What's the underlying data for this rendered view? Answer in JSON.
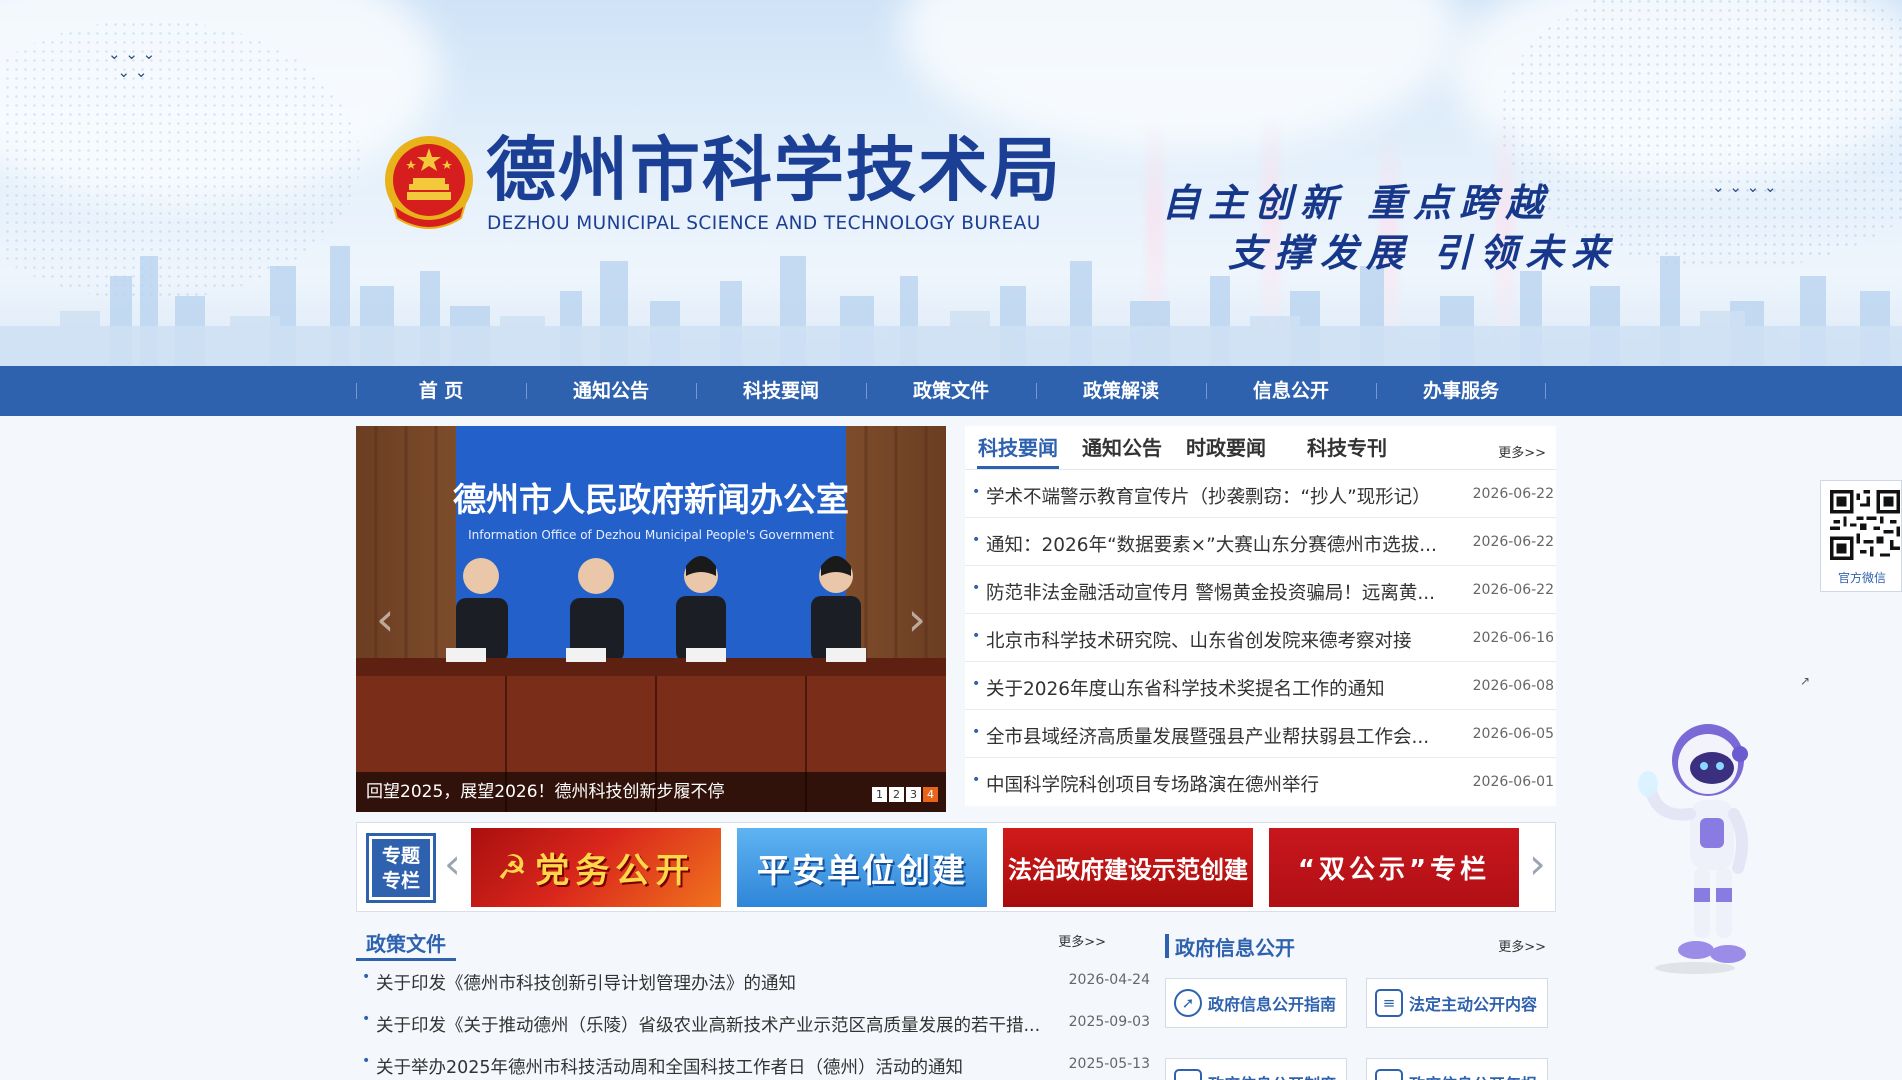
{
  "header": {
    "title": "德州市科学技术局",
    "subtitle": "DEZHOU MUNICIPAL SCIENCE AND TECHNOLOGY BUREAU",
    "slogan_line1": "自主创新 重点跨越",
    "slogan_line2": "支撑发展 引领未来"
  },
  "nav": {
    "items": [
      "首 页",
      "通知公告",
      "科技要闻",
      "政策文件",
      "政策解读",
      "信息公开",
      "办事服务"
    ]
  },
  "carousel": {
    "photo_banner_title": "德州市人民政府新闻办公室",
    "photo_banner_subtitle": "Information Office of Dezhou Municipal People's Government",
    "caption": "回望2025，展望2026！德州科技创新步履不停",
    "prev": "‹",
    "next": "›",
    "pages": [
      "1",
      "2",
      "3",
      "4"
    ],
    "active_page": "4"
  },
  "news": {
    "tabs": [
      "科技要闻",
      "通知公告",
      "时政要闻",
      "科技专刊"
    ],
    "active_tab": "科技要闻",
    "more": "更多>>",
    "bullet": "•",
    "items": [
      {
        "title": "学术不端警示教育宣传片（抄袭剽窃：“抄人”现形记）",
        "date": "2026-06-22"
      },
      {
        "title": "通知：2026年“数据要素×”大赛山东分赛德州市选拔...",
        "date": "2026-06-22"
      },
      {
        "title": "防范非法金融活动宣传月 警惕黄金投资骗局！远离黄...",
        "date": "2026-06-22"
      },
      {
        "title": "北京市科学技术研究院、山东省创发院来德考察对接",
        "date": "2026-06-16"
      },
      {
        "title": "关于2026年度山东省科学技术奖提名工作的通知",
        "date": "2026-06-08"
      },
      {
        "title": "全市县域经济高质量发展暨强县产业帮扶弱县工作会...",
        "date": "2026-06-05"
      },
      {
        "title": "中国科学院科创项目专场路演在德州举行",
        "date": "2026-06-01"
      }
    ]
  },
  "feature": {
    "label_line1": "专题",
    "label_line2": "专栏",
    "prev": "‹",
    "next": "›",
    "banners": [
      "党务公开",
      "平安单位创建",
      "法治政府建设示范创建",
      "“双公示”专栏"
    ]
  },
  "policy": {
    "title": "政策文件",
    "more": "更多>>",
    "bullet": "•",
    "items": [
      {
        "title": "关于印发《德州市科技创新引导计划管理办法》的通知",
        "date": "2026-04-24"
      },
      {
        "title": "关于印发《关于推动德州（乐陵）省级农业高新技术产业示范区高质量发展的若干措...",
        "date": "2025-09-03"
      },
      {
        "title": "关于举办2025年德州市科技活动周和全国科技工作者日（德州）活动的通知",
        "date": "2025-05-13"
      }
    ]
  },
  "gov_info": {
    "title": "政府信息公开",
    "more": "更多>>",
    "buttons": [
      "政府信息公开指南",
      "法定主动公开内容",
      "政府信息公开制度",
      "政府信息公开年报"
    ]
  },
  "sidebar_float": {
    "qr_label": "官方微信",
    "close": "↗"
  },
  "colors": {
    "primary": "#2f62ae",
    "title_blue": "#1b3f94",
    "active_dot": "#e8641b",
    "party_red": "#c8161d"
  }
}
